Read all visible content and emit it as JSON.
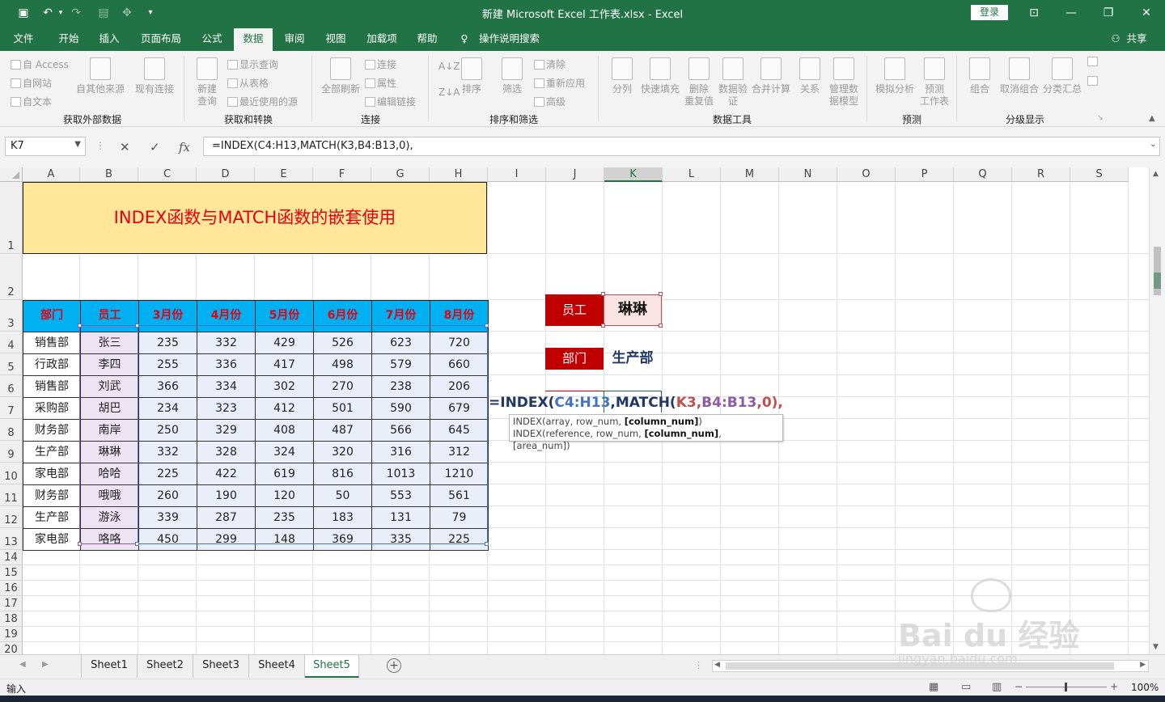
{
  "app": {
    "window_title": "新建 Microsoft Excel 工作表.xlsx  -  Excel",
    "login_label": "登录",
    "share_label": "共享"
  },
  "ribbon_tabs": [
    "文件",
    "开始",
    "插入",
    "页面布局",
    "公式",
    "数据",
    "审阅",
    "视图",
    "加载项",
    "帮助"
  ],
  "active_tab": "数据",
  "tell_me": "操作说明搜索",
  "ribbon": {
    "groups": {
      "get_external": "获取外部数据",
      "get_transform": "获取和转换",
      "connections": "连接",
      "sort_filter": "排序和筛选",
      "data_tools": "数据工具",
      "forecast": "预测",
      "outline": "分级显示"
    },
    "small": {
      "from_access": "自 Access",
      "from_web": "自网站",
      "from_text": "自文本",
      "show_queries": "显示查询",
      "from_table": "从表格",
      "recent_sources": "最近使用的源",
      "connections": "连接",
      "properties": "属性",
      "edit_links": "编辑链接",
      "clear": "清除",
      "reapply": "重新应用",
      "advanced": "高级"
    },
    "big": {
      "from_other": "自其他来源",
      "existing": "现有连接",
      "new_query_1": "新建",
      "new_query_2": "查询",
      "refresh_all": "全部刷新",
      "sort": "排序",
      "filter": "筛选",
      "split": "分列",
      "flash_fill": "快速填充",
      "remove_dup_1": "删除",
      "remove_dup_2": "重复值",
      "validation_1": "数据验",
      "validation_2": "证",
      "consolidate": "合并计算",
      "relations": "关系",
      "manage_model_1": "管理数",
      "manage_model_2": "据模型",
      "what_if": "模拟分析",
      "forecast_sheet_1": "预测",
      "forecast_sheet_2": "工作表",
      "group": "组合",
      "ungroup": "取消组合",
      "subtotal": "分类汇总"
    }
  },
  "formula_bar": {
    "name_box": "K7",
    "formula": "=INDEX(C4:H13,MATCH(K3,B4:B13,0),"
  },
  "columns": [
    "A",
    "B",
    "C",
    "D",
    "E",
    "F",
    "G",
    "H",
    "I",
    "J",
    "K",
    "L",
    "M",
    "N",
    "O",
    "P",
    "Q",
    "R",
    "S"
  ],
  "rows": [
    "1",
    "2",
    "3",
    "4",
    "5",
    "6",
    "7",
    "8",
    "9",
    "10",
    "11",
    "12",
    "13",
    "14",
    "15",
    "16",
    "17",
    "18",
    "19",
    "20"
  ],
  "sheet": {
    "title": "INDEX函数与MATCH函数的嵌套使用",
    "headers": [
      "部门",
      "员工",
      "3月份",
      "4月份",
      "5月份",
      "6月份",
      "7月份",
      "8月份"
    ],
    "rows": [
      [
        "销售部",
        "张三",
        "235",
        "332",
        "429",
        "526",
        "623",
        "720"
      ],
      [
        "行政部",
        "李四",
        "255",
        "336",
        "417",
        "498",
        "579",
        "660"
      ],
      [
        "销售部",
        "刘武",
        "366",
        "334",
        "302",
        "270",
        "238",
        "206"
      ],
      [
        "采购部",
        "胡巴",
        "234",
        "323",
        "412",
        "501",
        "590",
        "679"
      ],
      [
        "财务部",
        "南岸",
        "250",
        "329",
        "408",
        "487",
        "566",
        "645"
      ],
      [
        "生产部",
        "琳琳",
        "332",
        "328",
        "324",
        "320",
        "316",
        "312"
      ],
      [
        "家电部",
        "哈哈",
        "225",
        "422",
        "619",
        "816",
        "1013",
        "1210"
      ],
      [
        "财务部",
        "哦哦",
        "260",
        "190",
        "120",
        "50",
        "553",
        "561"
      ],
      [
        "生产部",
        "游泳",
        "339",
        "287",
        "235",
        "183",
        "131",
        "79"
      ],
      [
        "家电部",
        "咯咯",
        "450",
        "299",
        "148",
        "369",
        "335",
        "225"
      ]
    ],
    "lookup": {
      "emp_label": "员工",
      "emp_value": "琳琳",
      "dept_label": "部门",
      "dept_value": "生产部"
    },
    "incell_formula": {
      "p1": "=INDEX(",
      "p2": "C4:H13",
      "p3": ",MATCH(",
      "p4": "K3",
      "p5": ",",
      "p6": "B4:B13",
      "p7": ",0),"
    },
    "tooltip": {
      "line1_a": "INDEX(array, row_num, ",
      "line1_b": "[column_num]",
      "line1_c": ")",
      "line2_a": "INDEX(reference, row_num, ",
      "line2_b": "[column_num]",
      "line2_c": ", [area_num])"
    }
  },
  "sheet_tabs": [
    "Sheet1",
    "Sheet2",
    "Sheet3",
    "Sheet4",
    "Sheet5"
  ],
  "active_sheet": "Sheet5",
  "status": {
    "mode": "输入",
    "zoom": "100%"
  },
  "watermark": {
    "brand": "Bai du 经验",
    "url": "jingyan.baidu.com"
  },
  "colors": {
    "excel_green": "#217346",
    "title_fill": "#ffe699",
    "header_fill": "#00b0f0",
    "header_text": "#e60012",
    "lookup_label_fill": "#c00000"
  }
}
